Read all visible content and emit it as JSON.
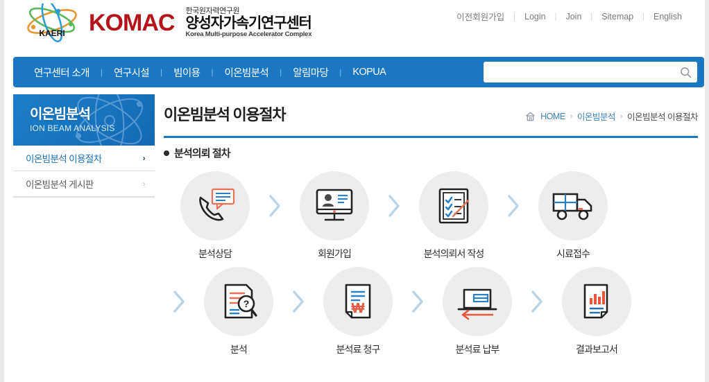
{
  "header": {
    "logo": {
      "kaeri_text": "KAERI",
      "komac_word": "KOMAC",
      "org_line1": "한국원자력연구원",
      "org_line2": "양성자가속기연구센터",
      "org_line3": "Korea Multi-purpose Accelerator Complex"
    },
    "util_nav": [
      {
        "label": "이전회원가입"
      },
      {
        "label": "Login"
      },
      {
        "label": "Join"
      },
      {
        "label": "Sitemap"
      },
      {
        "label": "English"
      }
    ],
    "separator": "|"
  },
  "gnb": {
    "items": [
      {
        "label": "연구센터 소개"
      },
      {
        "label": "연구시설"
      },
      {
        "label": "빔이용"
      },
      {
        "label": "이온빔분석"
      },
      {
        "label": "알림마당"
      },
      {
        "label": "KOPUA"
      }
    ],
    "separator": "|",
    "bg_color": "#1b77c4"
  },
  "search": {
    "value": "",
    "placeholder": "",
    "icon": "search-icon"
  },
  "sidebar": {
    "banner": {
      "title_kr": "이온빔분석",
      "title_en": "ION BEAM ANALYSIS"
    },
    "items": [
      {
        "label": "이온빔분석 이용절차",
        "active": true,
        "chevron": "›"
      },
      {
        "label": "이온빔분석 게시판",
        "active": false,
        "chevron": "›"
      }
    ]
  },
  "content": {
    "page_title": "이온빔분석 이용절차",
    "breadcrumb": {
      "home_icon": "home-icon",
      "home": "HOME",
      "arrow": "›",
      "level2": "이온빔분석",
      "current": "이온빔분석 이용절차"
    },
    "section_heading": "분석의뢰 절차",
    "rule_color": "#2278b8",
    "process": {
      "chevron": "›",
      "row1": [
        {
          "caption": "분석상담",
          "icon": "phone-chat-icon"
        },
        {
          "caption": "회원가입",
          "icon": "monitor-profile-icon"
        },
        {
          "caption": "분석의뢰서 작성",
          "icon": "checklist-pen-icon"
        },
        {
          "caption": "시료접수",
          "icon": "delivery-truck-icon"
        }
      ],
      "row2": [
        {
          "caption": "분석",
          "icon": "document-magnifier-icon"
        },
        {
          "caption": "분석료 청구",
          "icon": "invoice-won-icon"
        },
        {
          "caption": "분석료 납부",
          "icon": "laptop-payment-icon"
        },
        {
          "caption": "결과보고서",
          "icon": "report-chart-icon"
        }
      ]
    }
  }
}
